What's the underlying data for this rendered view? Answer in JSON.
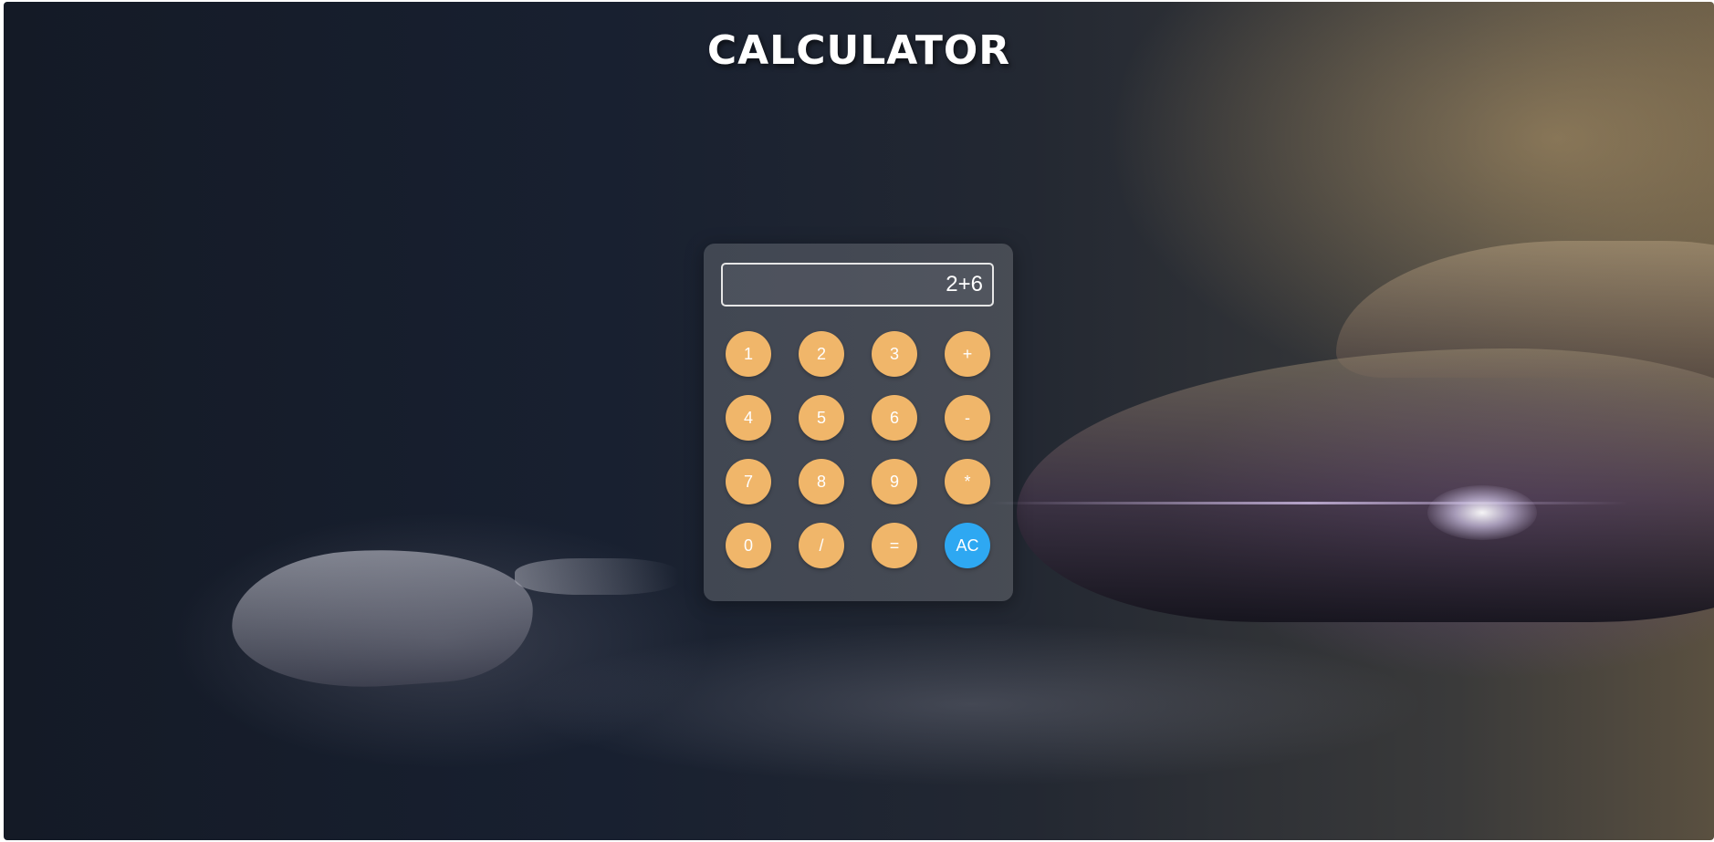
{
  "page": {
    "title": "CALCULATOR"
  },
  "calculator": {
    "display_value": "2+6",
    "keys": [
      "1",
      "2",
      "3",
      "+",
      "4",
      "5",
      "6",
      "-",
      "7",
      "8",
      "9",
      "*",
      "0",
      "/",
      "=",
      "AC"
    ]
  },
  "colors": {
    "key_background": "#f0b66a",
    "clear_key_background": "#2ea8f2",
    "key_text": "#ffffff"
  }
}
